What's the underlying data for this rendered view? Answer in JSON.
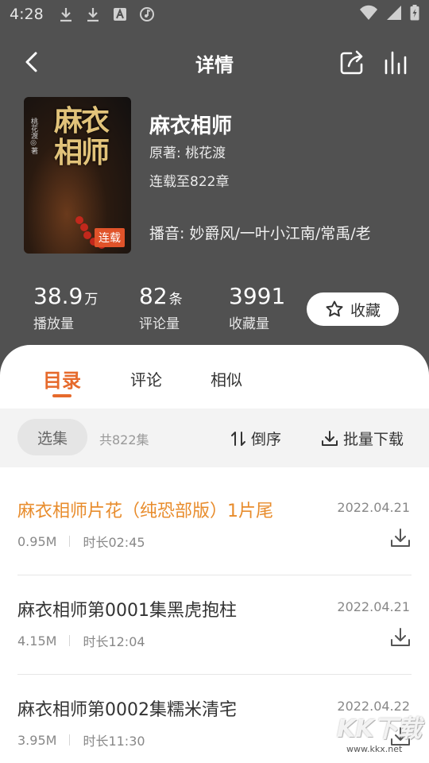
{
  "status_bar": {
    "time": "4:28"
  },
  "header": {
    "title": "详情"
  },
  "book": {
    "cover_title": "麻衣相师",
    "cover_author": "桃花渡◎著",
    "cover_badge": "连载",
    "name": "麻衣相师",
    "author": "原著: 桃花渡",
    "progress": "连载至822章",
    "narrator": "播音: 妙爵风/一叶小江南/常禹/老"
  },
  "stats": [
    {
      "value": "38.9",
      "unit": "万",
      "label": "播放量"
    },
    {
      "value": "82",
      "unit": "条",
      "label": "评论量"
    },
    {
      "value": "3991",
      "unit": "",
      "label": "收藏量"
    }
  ],
  "favorite_label": "收藏",
  "tabs": [
    {
      "label": "目录",
      "active": true
    },
    {
      "label": "评论",
      "active": false
    },
    {
      "label": "相似",
      "active": false
    }
  ],
  "toolbar": {
    "select_label": "选集",
    "total": "共822集",
    "sort_label": "倒序",
    "batch_label": "批量下载"
  },
  "episodes": [
    {
      "title": "麻衣相师片花（纯恐部版）1片尾",
      "date": "2022.04.21",
      "size": "0.95M",
      "duration": "时长02:45",
      "playing": true
    },
    {
      "title": "麻衣相师第0001集黑虎抱柱",
      "date": "2022.04.21",
      "size": "4.15M",
      "duration": "时长12:04",
      "playing": false
    },
    {
      "title": "麻衣相师第0002集糯米清宅",
      "date": "2022.04.22",
      "size": "3.95M",
      "duration": "时长11:30",
      "playing": false
    }
  ],
  "watermark": {
    "text": "KK下载",
    "url": "www.kkx.net"
  },
  "colors": {
    "accent": "#e66a2c",
    "playing": "#e88c2c",
    "header_bg": "#515151"
  }
}
